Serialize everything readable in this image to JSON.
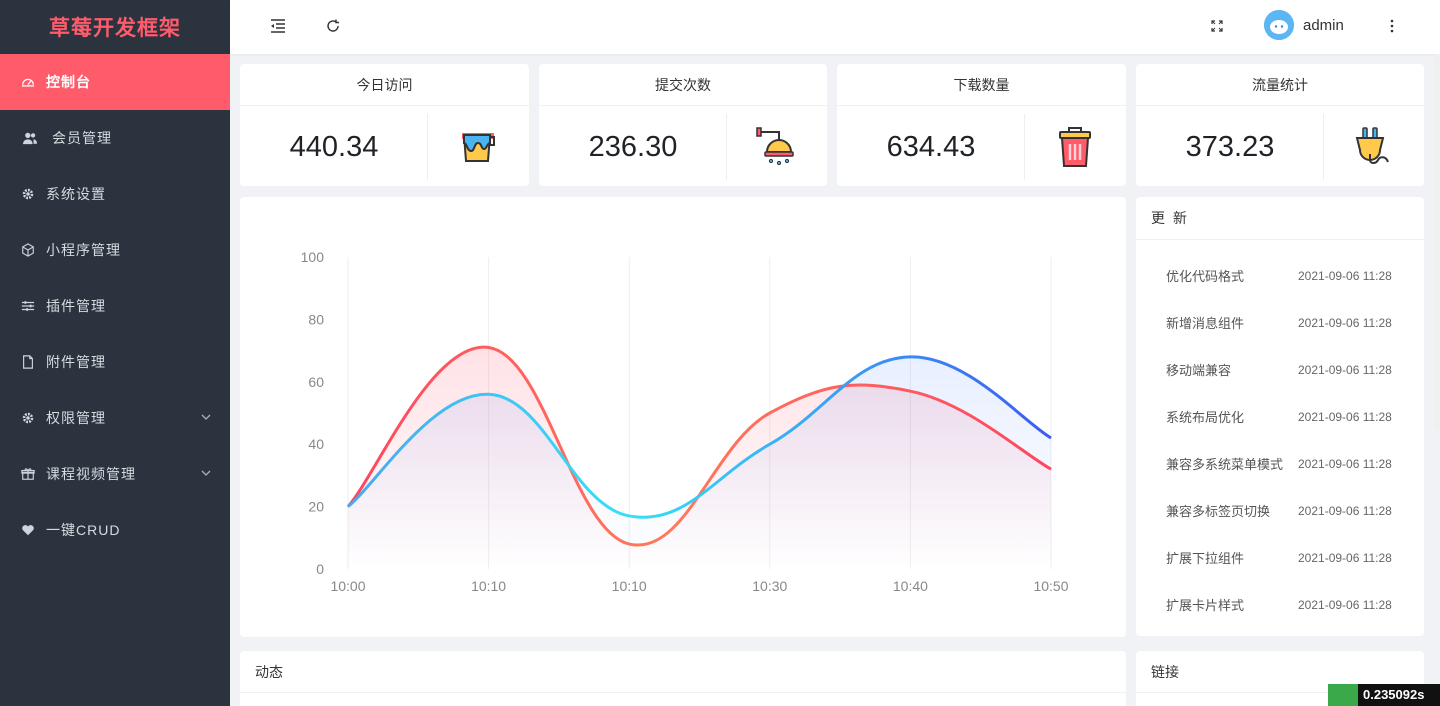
{
  "brand": {
    "title": "草莓开发框架"
  },
  "sidebar": {
    "items": [
      {
        "label": "控制台",
        "icon": "dashboard-icon",
        "active": true
      },
      {
        "label": "会员管理",
        "icon": "users-icon"
      },
      {
        "label": "系统设置",
        "icon": "gear-icon"
      },
      {
        "label": "小程序管理",
        "icon": "cube-icon"
      },
      {
        "label": "插件管理",
        "icon": "sliders-icon"
      },
      {
        "label": "附件管理",
        "icon": "file-icon"
      },
      {
        "label": "权限管理",
        "icon": "gear-icon",
        "expandable": true
      },
      {
        "label": "课程视频管理",
        "icon": "gift-icon",
        "expandable": true
      },
      {
        "label": "一键CRUD",
        "icon": "heart-icon"
      }
    ]
  },
  "header": {
    "username": "admin"
  },
  "stats": [
    {
      "title": "今日访问",
      "value": "440.34",
      "icon": "paint-bucket-icon"
    },
    {
      "title": "提交次数",
      "value": "236.30",
      "icon": "shower-icon"
    },
    {
      "title": "下载数量",
      "value": "634.43",
      "icon": "trash-can-icon"
    },
    {
      "title": "流量统计",
      "value": "373.23",
      "icon": "plug-icon"
    }
  ],
  "chart_data": {
    "type": "area",
    "categories": [
      "10:00",
      "10:10",
      "10:10",
      "10:30",
      "10:40",
      "10:50"
    ],
    "ylim": [
      0,
      100
    ],
    "yticks": [
      0,
      20,
      40,
      60,
      80,
      100
    ],
    "series": [
      {
        "values": [
          20,
          71,
          8,
          50,
          57,
          32
        ],
        "color": "#ff4560"
      },
      {
        "values": [
          20,
          56,
          17,
          40,
          68,
          42
        ],
        "color": "#3d7cf4"
      }
    ],
    "grid": "vertical"
  },
  "updates": {
    "title": "更 新",
    "items": [
      {
        "text": "优化代码格式",
        "time": "2021-09-06 11:28"
      },
      {
        "text": "新增消息组件",
        "time": "2021-09-06 11:28"
      },
      {
        "text": "移动端兼容",
        "time": "2021-09-06 11:28"
      },
      {
        "text": "系统布局优化",
        "time": "2021-09-06 11:28"
      },
      {
        "text": "兼容多系统菜单模式",
        "time": "2021-09-06 11:28"
      },
      {
        "text": "兼容多标签页切换",
        "time": "2021-09-06 11:28"
      },
      {
        "text": "扩展下拉组件",
        "time": "2021-09-06 11:28"
      },
      {
        "text": "扩展卡片样式",
        "time": "2021-09-06 11:28"
      }
    ]
  },
  "activity": {
    "title": "动态"
  },
  "links": {
    "title": "链接"
  },
  "timer": {
    "value": "0.235092s"
  },
  "colors": {
    "accent": "#ff5b6b",
    "sidebar_bg": "#2b333e"
  }
}
